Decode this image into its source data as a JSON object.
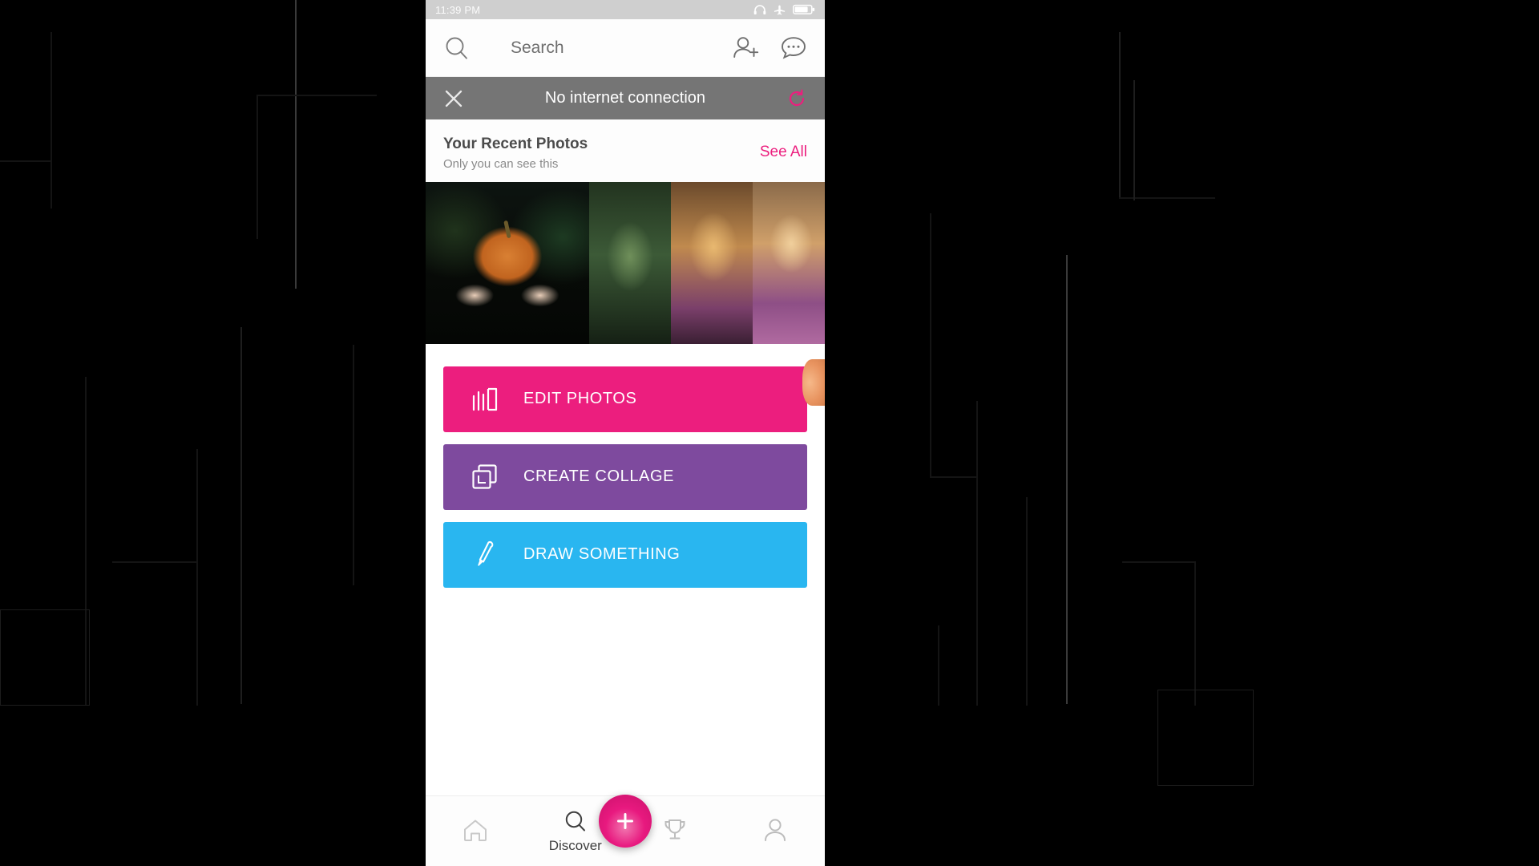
{
  "status_bar": {
    "time": "11:39 PM",
    "icons": [
      "headset-icon",
      "airplane-mode-icon",
      "battery-icon"
    ]
  },
  "search": {
    "placeholder": "Search",
    "search_icon": "search-icon",
    "add_friend_icon": "add-person-icon",
    "messages_icon": "chat-bubble-icon"
  },
  "banner": {
    "message": "No internet connection",
    "close_icon": "close-icon",
    "retry_icon": "refresh-icon",
    "background": "#757575"
  },
  "recent_photos": {
    "title": "Your Recent Photos",
    "subtitle": "Only you can see this",
    "see_all_label": "See All",
    "see_all_color": "#ec1e7e",
    "thumbnails": [
      {
        "name": "photo-pumpkin-face"
      },
      {
        "name": "photo-green-portrait"
      },
      {
        "name": "photo-golden-portrait"
      },
      {
        "name": "photo-purple-portrait"
      },
      {
        "name": "photo-smoke-portrait"
      }
    ]
  },
  "actions": [
    {
      "label": "EDIT PHOTOS",
      "color": "#ec1e7e",
      "icon": "photo-edit-icon"
    },
    {
      "label": "CREATE COLLAGE",
      "color": "#7e4a9e",
      "icon": "collage-icon"
    },
    {
      "label": "DRAW SOMETHING",
      "color": "#29b6f0",
      "icon": "brush-icon"
    }
  ],
  "bottom_nav": {
    "items": [
      {
        "label": "",
        "icon": "home-icon",
        "active": false
      },
      {
        "label": "Discover",
        "icon": "search-icon",
        "active": true
      },
      {
        "label": "",
        "icon": "trophy-icon",
        "active": false
      },
      {
        "label": "",
        "icon": "profile-icon",
        "active": false
      }
    ],
    "fab": {
      "icon": "plus-icon",
      "color": "#e8197f"
    }
  }
}
